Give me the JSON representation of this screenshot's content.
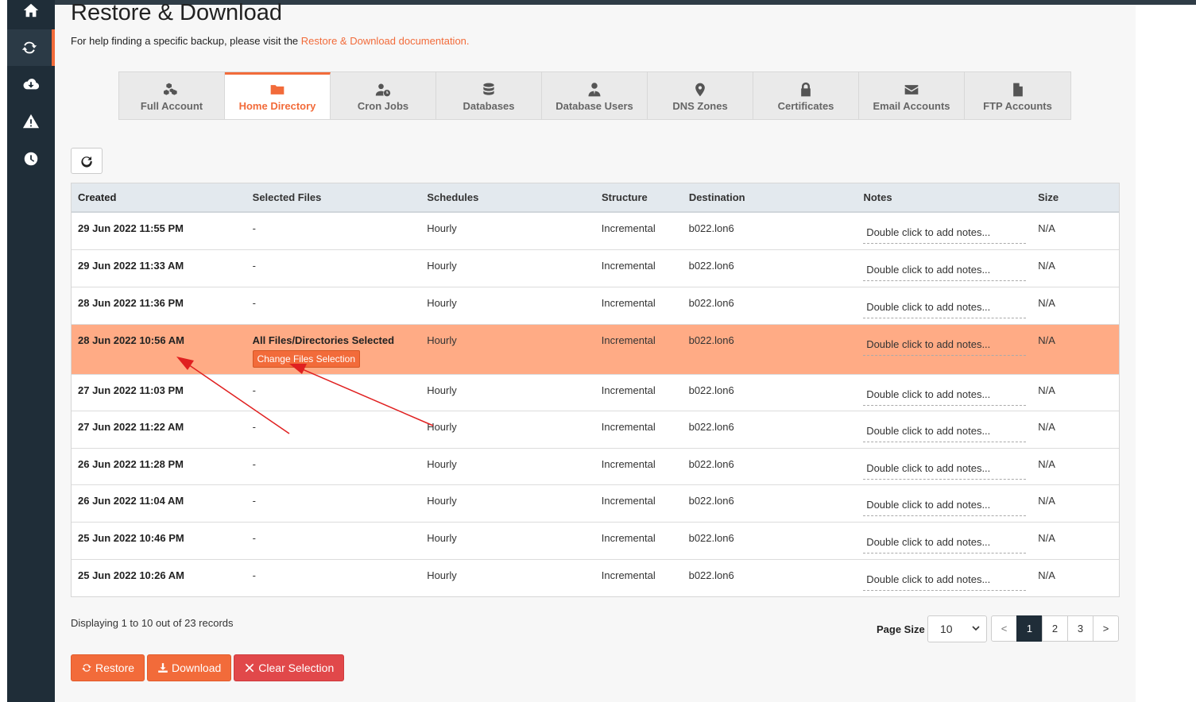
{
  "page": {
    "title": "Restore & Download",
    "help_prefix": "For help finding a specific backup, please visit the ",
    "help_link": "Restore & Download documentation."
  },
  "sidebar": {
    "items": [
      {
        "icon": "home-icon"
      },
      {
        "icon": "sync-icon",
        "active": true
      },
      {
        "icon": "cloud-download-icon"
      },
      {
        "icon": "warning-icon"
      },
      {
        "icon": "clock-icon"
      }
    ]
  },
  "tabs": [
    {
      "label": "Full Account",
      "icon": "cubes-icon"
    },
    {
      "label": "Home Directory",
      "icon": "folder-icon",
      "active": true
    },
    {
      "label": "Cron Jobs",
      "icon": "user-clock-icon"
    },
    {
      "label": "Databases",
      "icon": "database-icon"
    },
    {
      "label": "Database Users",
      "icon": "user-tie-icon"
    },
    {
      "label": "DNS Zones",
      "icon": "map-marker-icon"
    },
    {
      "label": "Certificates",
      "icon": "lock-icon"
    },
    {
      "label": "Email Accounts",
      "icon": "envelope-icon"
    },
    {
      "label": "FTP Accounts",
      "icon": "file-icon"
    }
  ],
  "table": {
    "headers": {
      "created": "Created",
      "files": "Selected Files",
      "schedules": "Schedules",
      "structure": "Structure",
      "destination": "Destination",
      "notes": "Notes",
      "size": "Size"
    },
    "rows": [
      {
        "created": "29 Jun 2022 11:55 PM",
        "files": "-",
        "schedules": "Hourly",
        "structure": "Incremental",
        "destination": "b022.lon6",
        "notes": "Double click to add notes...",
        "size": "N/A"
      },
      {
        "created": "29 Jun 2022 11:33 AM",
        "files": "-",
        "schedules": "Hourly",
        "structure": "Incremental",
        "destination": "b022.lon6",
        "notes": "Double click to add notes...",
        "size": "N/A"
      },
      {
        "created": "28 Jun 2022 11:36 PM",
        "files": "-",
        "schedules": "Hourly",
        "structure": "Incremental",
        "destination": "b022.lon6",
        "notes": "Double click to add notes...",
        "size": "N/A"
      },
      {
        "created": "28 Jun 2022 10:56 AM",
        "files": "All Files/Directories Selected",
        "change_label": "Change Files Selection",
        "selected": true,
        "schedules": "Hourly",
        "structure": "Incremental",
        "destination": "b022.lon6",
        "notes": "Double click to add notes...",
        "size": "N/A"
      },
      {
        "created": "27 Jun 2022 11:03 PM",
        "files": "-",
        "schedules": "Hourly",
        "structure": "Incremental",
        "destination": "b022.lon6",
        "notes": "Double click to add notes...",
        "size": "N/A"
      },
      {
        "created": "27 Jun 2022 11:22 AM",
        "files": "-",
        "schedules": "Hourly",
        "structure": "Incremental",
        "destination": "b022.lon6",
        "notes": "Double click to add notes...",
        "size": "N/A"
      },
      {
        "created": "26 Jun 2022 11:28 PM",
        "files": "-",
        "schedules": "Hourly",
        "structure": "Incremental",
        "destination": "b022.lon6",
        "notes": "Double click to add notes...",
        "size": "N/A"
      },
      {
        "created": "26 Jun 2022 11:04 AM",
        "files": "-",
        "schedules": "Hourly",
        "structure": "Incremental",
        "destination": "b022.lon6",
        "notes": "Double click to add notes...",
        "size": "N/A"
      },
      {
        "created": "25 Jun 2022 10:46 PM",
        "files": "-",
        "schedules": "Hourly",
        "structure": "Incremental",
        "destination": "b022.lon6",
        "notes": "Double click to add notes...",
        "size": "N/A"
      },
      {
        "created": "25 Jun 2022 10:26 AM",
        "files": "-",
        "schedules": "Hourly",
        "structure": "Incremental",
        "destination": "b022.lon6",
        "notes": "Double click to add notes...",
        "size": "N/A"
      }
    ]
  },
  "footer": {
    "display_count": "Displaying 1 to 10 out of 23 records",
    "page_size_label": "Page Size",
    "page_size_value": "10",
    "pager": {
      "prev": "<",
      "pages": [
        "1",
        "2",
        "3"
      ],
      "next": ">",
      "current": "1"
    }
  },
  "actions": {
    "restore": "Restore",
    "download": "Download",
    "clear": "Clear Selection"
  },
  "colors": {
    "accent": "#f26b3a",
    "sidebar": "#1f2d38",
    "selected_row": "#ffab85",
    "danger": "#e1484a",
    "annotation_arrow": "#e02020"
  }
}
